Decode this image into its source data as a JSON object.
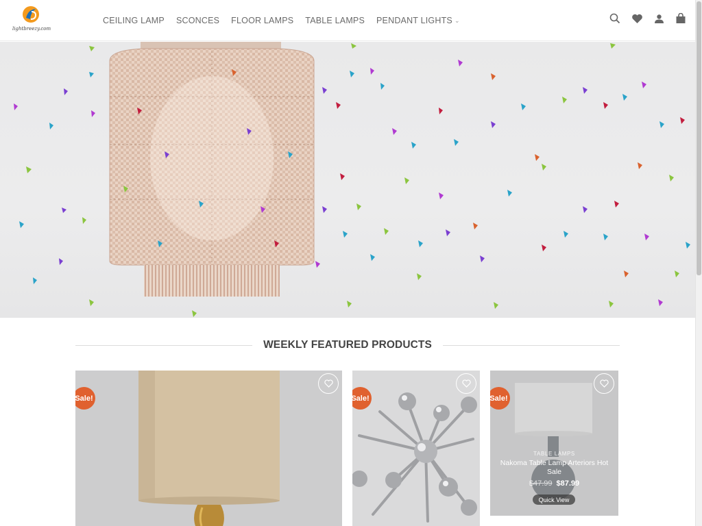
{
  "logo": {
    "text": "lightbreezy.com"
  },
  "nav": {
    "items": [
      {
        "label": "CEILING LAMP"
      },
      {
        "label": "SCONCES"
      },
      {
        "label": "FLOOR LAMPS"
      },
      {
        "label": "TABLE LAMPS"
      },
      {
        "label": "PENDANT LIGHTS",
        "has_dropdown": true
      }
    ]
  },
  "header_icons": [
    "search-icon",
    "heart-icon",
    "user-icon",
    "shopping-bag-icon"
  ],
  "hero": {
    "icons": [
      "pendant-lamp-image",
      "confetti-decoration"
    ]
  },
  "section": {
    "title": "WEEKLY FEATURED PRODUCTS"
  },
  "products": [
    {
      "badge": "Sale!",
      "image": "drum-shade-table-lamp"
    },
    {
      "badge": "Sale!",
      "image": "sputnik-chrome-chandelier"
    },
    {
      "badge": "Sale!",
      "image": "white-shade-table-lamp",
      "category": "TABLE LAMPS",
      "title": "Nakoma Table Lamp Arteriors Hot Sale",
      "old_price": "$47.99",
      "new_price": "$87.99",
      "quick_view": "Quick View"
    }
  ],
  "colors": {
    "sale_badge": "#e0612f",
    "logo_orange": "#f39a1e",
    "logo_blue": "#1d6fb8"
  }
}
